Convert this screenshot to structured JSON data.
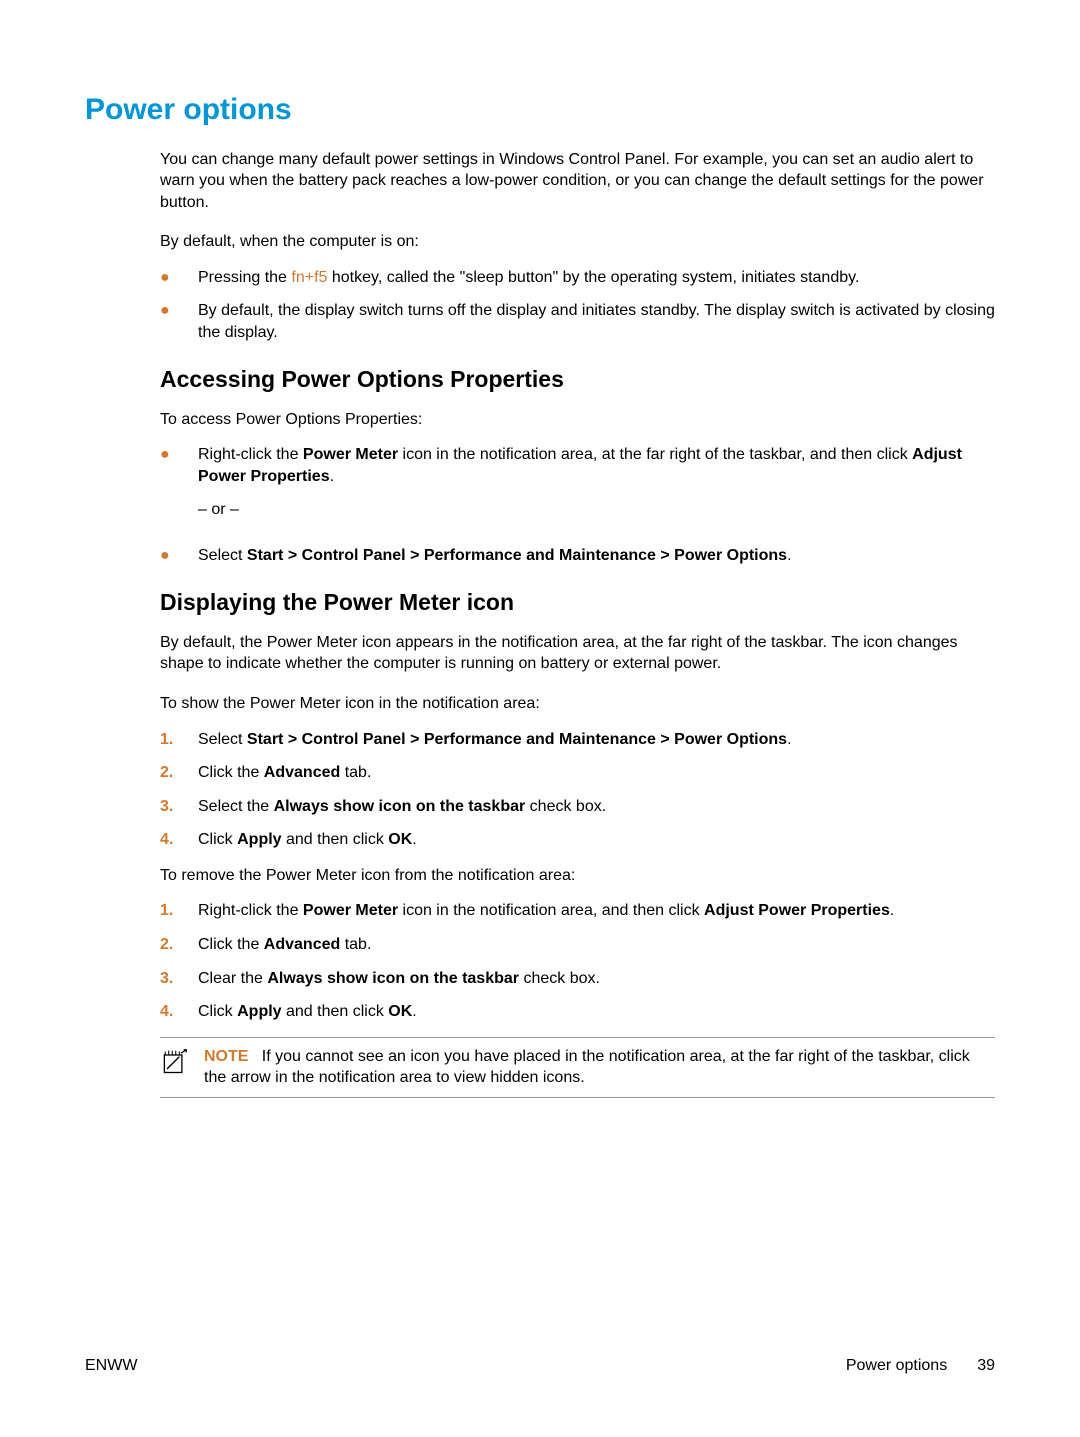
{
  "title": "Power options",
  "intro": "You can change many default power settings in Windows Control Panel. For example, you can set an audio alert to warn you when the battery pack reaches a low-power condition, or you can change the default settings for the power button.",
  "lead1": "By default, when the computer is on:",
  "bullets1": {
    "b0a": "Pressing the ",
    "b0hot": "fn+f5",
    "b0b": " hotkey, called the \"sleep button\" by the operating system, initiates standby.",
    "b1": "By default, the display switch turns off the display and initiates standby. The display switch is activated by closing the display."
  },
  "sec1": {
    "heading": "Accessing Power Options Properties",
    "lead": "To access Power Options Properties:",
    "b0a": "Right-click the ",
    "b0b": "Power Meter",
    "b0c": " icon in the notification area, at the far right of the taskbar, and then click ",
    "b0d": "Adjust Power Properties",
    "b0e": ".",
    "or": "– or –",
    "b1a": "Select ",
    "b1b": "Start > Control Panel > Performance and Maintenance > Power Options",
    "b1c": "."
  },
  "sec2": {
    "heading": "Displaying the Power Meter icon",
    "p1": "By default, the Power Meter icon appears in the notification area, at the far right of the taskbar. The icon changes shape to indicate whether the computer is running on battery or external power.",
    "lead2": "To show the Power Meter icon in the notification area:",
    "show": {
      "s1a": "Select ",
      "s1b": "Start > Control Panel > Performance and Maintenance > Power Options",
      "s1c": ".",
      "s2a": "Click the ",
      "s2b": "Advanced",
      "s2c": " tab.",
      "s3a": "Select the ",
      "s3b": "Always show icon on the taskbar",
      "s3c": " check box.",
      "s4a": "Click ",
      "s4b": "Apply",
      "s4c": " and then click ",
      "s4d": "OK",
      "s4e": "."
    },
    "lead3": "To remove the Power Meter icon from the notification area:",
    "remove": {
      "r1a": "Right-click the ",
      "r1b": "Power Meter",
      "r1c": " icon in the notification area, and then click ",
      "r1d": "Adjust Power Properties",
      "r1e": ".",
      "r2a": "Click the ",
      "r2b": "Advanced",
      "r2c": " tab.",
      "r3a": "Clear the ",
      "r3b": "Always show icon on the taskbar",
      "r3c": " check box.",
      "r4a": "Click ",
      "r4b": "Apply",
      "r4c": " and then click ",
      "r4d": "OK",
      "r4e": "."
    },
    "note_label": "NOTE",
    "note_text": "If you cannot see an icon you have placed in the notification area, at the far right of the taskbar, click the arrow in the notification area to view hidden icons."
  },
  "footer": {
    "left": "ENWW",
    "right_label": "Power options",
    "page": "39"
  }
}
